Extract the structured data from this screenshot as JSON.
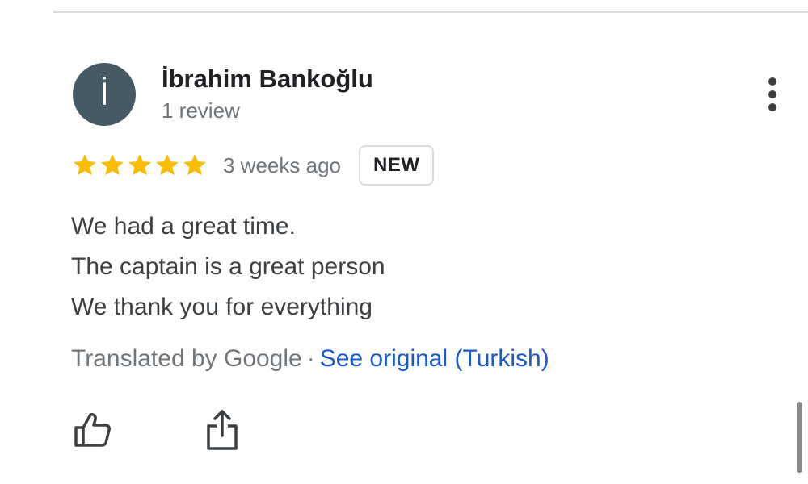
{
  "review": {
    "reviewer": {
      "initial": "İ",
      "name": "İbrahim Bankoğlu",
      "review_count": "1 review",
      "avatar_color": "#455a64"
    },
    "rating": 5,
    "rating_max": 5,
    "star_color": "#fbbc04",
    "date": "3 weeks ago",
    "badge": "NEW",
    "text_lines": [
      "We had a great time.",
      "The captain is a great person",
      "We thank you for everything"
    ],
    "translation": {
      "label": "Translated by Google",
      "separator": "·",
      "link": "See original (Turkish)",
      "link_color": "#1a59c6"
    },
    "actions": {
      "more_icon": "more-vertical-icon",
      "like_icon": "thumbs-up-icon",
      "share_icon": "share-icon"
    }
  }
}
